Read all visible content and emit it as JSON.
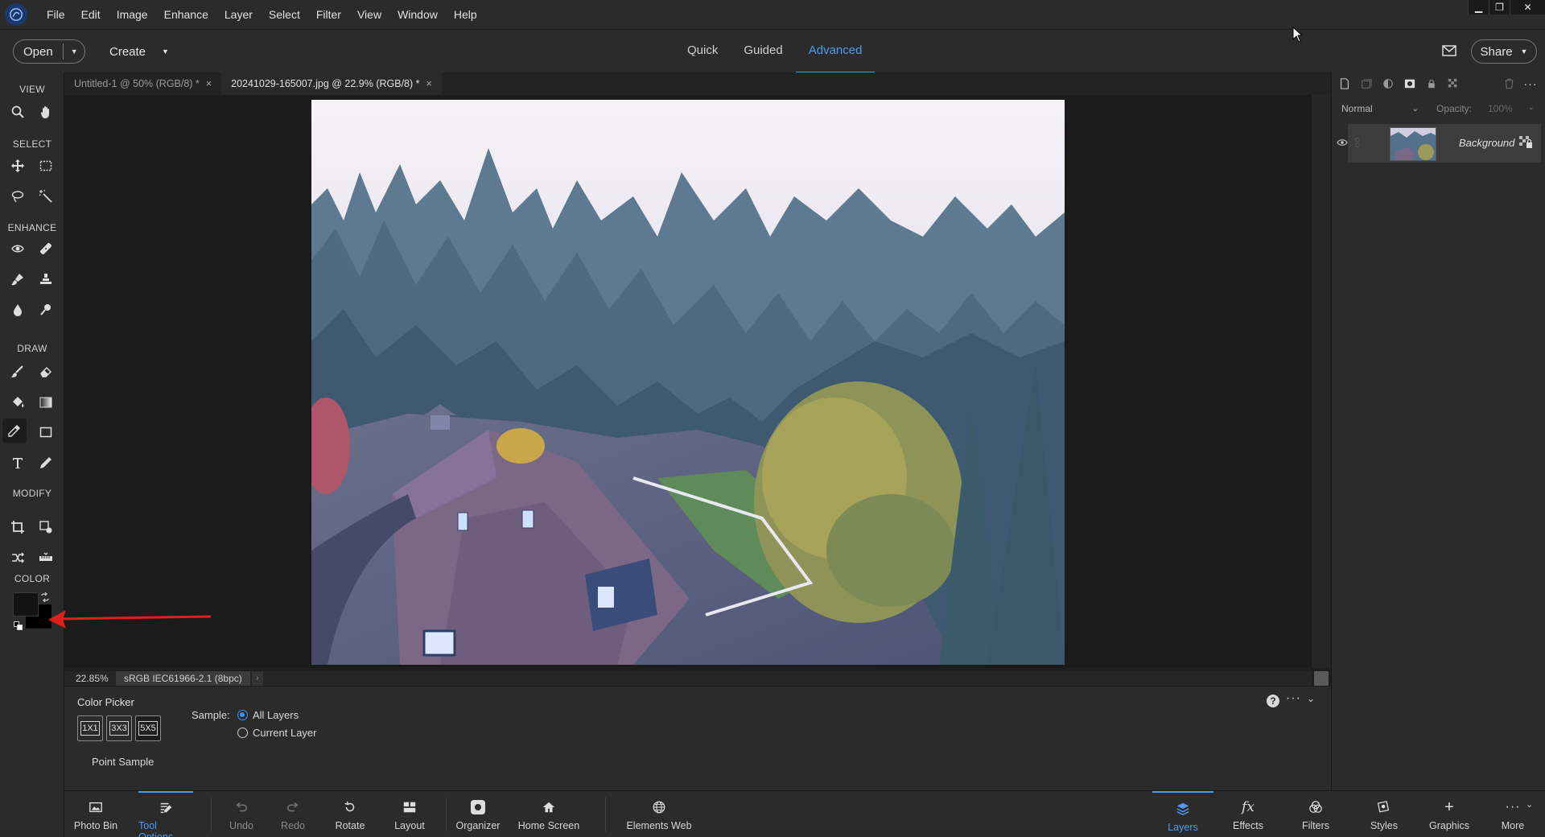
{
  "menu": [
    "File",
    "Edit",
    "Image",
    "Enhance",
    "Layer",
    "Select",
    "Filter",
    "View",
    "Window",
    "Help"
  ],
  "modebar": {
    "open_label": "Open",
    "create_label": "Create",
    "tabs": [
      "Quick",
      "Guided",
      "Advanced"
    ],
    "active_tab": "Advanced",
    "share_label": "Share"
  },
  "toolbox": {
    "sections": {
      "view": "VIEW",
      "select": "SELECT",
      "enhance": "ENHANCE",
      "draw": "DRAW",
      "modify": "MODIFY",
      "color": "COLOR"
    },
    "active_tool": "eyedropper-icon",
    "foreground_color": "#141414",
    "background_color": "#000000"
  },
  "doc_tabs": [
    {
      "label": "Untitled-1 @ 50% (RGB/8) *",
      "close": "×"
    },
    {
      "label": "20241029-165007.jpg @ 22.9% (RGB/8) *",
      "close": "×"
    }
  ],
  "status": {
    "zoom": "22.85%",
    "profile": "sRGB IEC61966-2.1 (8bpc)",
    "arrow": "›"
  },
  "tool_options": {
    "title": "Color Picker",
    "sample_sizes": [
      "1X1",
      "3X3",
      "5X5"
    ],
    "active_size": "5X5",
    "point_sample": "Point Sample",
    "sample_label": "Sample:",
    "sample_options": [
      "All Layers",
      "Current Layer"
    ],
    "selected_sample": "All Layers"
  },
  "taskbar": {
    "photo_bin": "Photo Bin",
    "tool_options": "Tool Options",
    "undo": "Undo",
    "redo": "Redo",
    "rotate": "Rotate",
    "layout": "Layout",
    "organizer": "Organizer",
    "home_screen": "Home Screen",
    "elements_web": "Elements Web",
    "layers": "Layers",
    "effects": "Effects",
    "filters": "Filters",
    "styles": "Styles",
    "graphics": "Graphics",
    "more": "More"
  },
  "layers_panel": {
    "blend_mode": "Normal",
    "opacity_label": "Opacity:",
    "opacity_value": "100%",
    "layer_name": "Background"
  },
  "colors": {
    "accent": "#4e9bf0",
    "arrow": "#e0201b"
  }
}
